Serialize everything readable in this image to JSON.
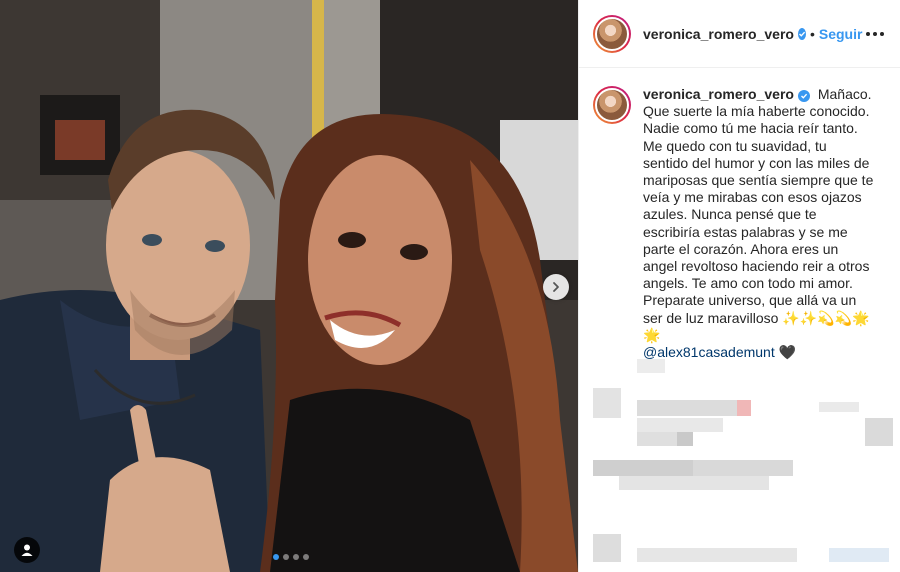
{
  "post": {
    "username": "veronica_romero_vero",
    "separator": "•",
    "follow_label": "Seguir",
    "more_icon": "more-options-icon",
    "verified_icon": "verified-badge-icon"
  },
  "caption": {
    "username": "veronica_romero_vero",
    "lines": [
      "Mañaco.",
      "Que suerte la mía haberte conocido.",
      "Nadie como tú me hacia reír tanto.",
      "Me quedo con tu suavidad, tu",
      "sentido del humor y con las miles de",
      "mariposas que sentía siempre que te",
      "veía y me mirabas con esos ojazos",
      "azules. Nunca pensé que te",
      "escribiría estas palabras y se me",
      "parte el corazón. Ahora eres un",
      "angel revoltoso haciendo reir a otros",
      "angels. Te amo con todo mi amor.",
      "Preparate universo, que allá va un",
      "ser de luz maravilloso ✨✨💫💫🌟🌟"
    ],
    "mention": "@alex81casademunt",
    "trailing_emoji": "🖤"
  },
  "carousel": {
    "dot_count": 4,
    "active_index": 0,
    "next_icon": "chevron-right-icon",
    "tag_icon": "user-tag-icon"
  },
  "colors": {
    "accent": "#3897f0",
    "text": "#262626",
    "mention": "#00376b",
    "border": "#efefef"
  }
}
